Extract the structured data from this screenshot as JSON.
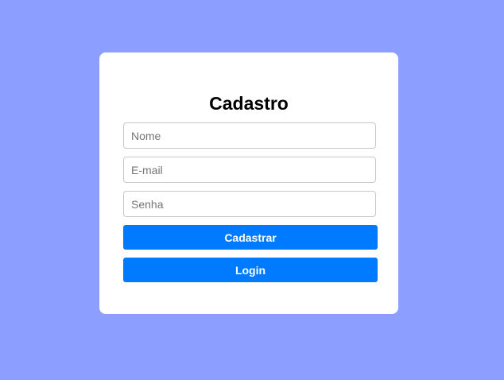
{
  "form": {
    "title": "Cadastro",
    "name_placeholder": "Nome",
    "email_placeholder": "E-mail",
    "password_placeholder": "Senha",
    "register_label": "Cadastrar",
    "login_label": "Login"
  },
  "colors": {
    "background": "#8c9eff",
    "card": "#ffffff",
    "button": "#007bff",
    "button_text": "#ffffff"
  }
}
